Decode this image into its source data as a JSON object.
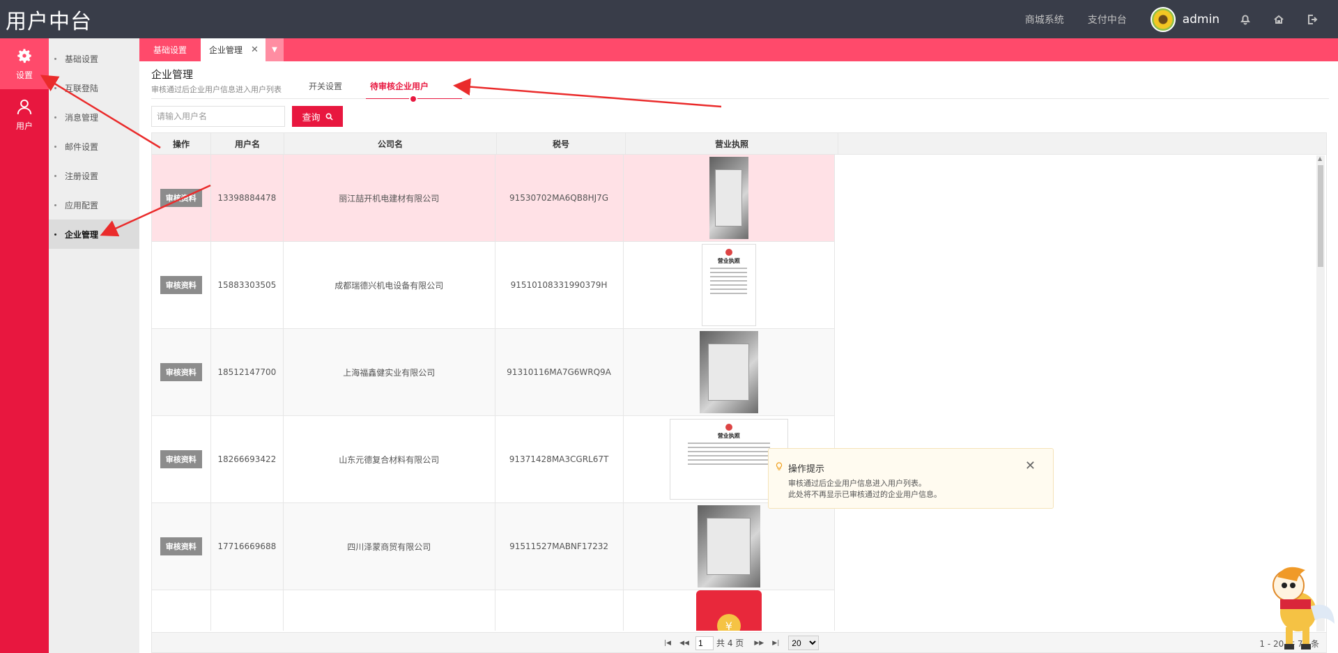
{
  "app": {
    "title": "用户中台"
  },
  "topbar": {
    "links": [
      "商城系统",
      "支付中台"
    ],
    "username": "admin",
    "icons": [
      "bell-icon",
      "home-icon",
      "logout-icon"
    ]
  },
  "leftnav": [
    {
      "label": "设置",
      "icon": "gear-icon",
      "active": true
    },
    {
      "label": "用户",
      "icon": "user-icon",
      "active": false
    }
  ],
  "submenu": [
    "基础设置",
    "互联登陆",
    "消息管理",
    "邮件设置",
    "注册设置",
    "应用配置",
    "企业管理"
  ],
  "tabs": [
    {
      "label": "基础设置"
    },
    {
      "label": "企业管理",
      "active": true
    }
  ],
  "page": {
    "title": "企业管理",
    "subtitle": "审核通过后企业用户信息进入用户列表",
    "subtabs": [
      "开关设置",
      "待审核企业用户"
    ]
  },
  "search": {
    "placeholder": "请输入用户名",
    "button": "查询"
  },
  "table": {
    "columns": [
      "操作",
      "用户名",
      "公司名",
      "税号",
      "营业执照"
    ],
    "action_label": "审核资料",
    "rows": [
      {
        "username": "13398884478",
        "company": "丽江喆开机电建材有限公司",
        "tax": "91530702MA6QB8HJ7G"
      },
      {
        "username": "15883303505",
        "company": "成都瑞德兴机电设备有限公司",
        "tax": "91510108331990379H"
      },
      {
        "username": "18512147700",
        "company": "上海福鑫健实业有限公司",
        "tax": "91310116MA7G6WRQ9A"
      },
      {
        "username": "18266693422",
        "company": "山东元德复合材料有限公司",
        "tax": "91371428MA3CGRL67T"
      },
      {
        "username": "17716669688",
        "company": "四川泽蒙商贸有限公司",
        "tax": "91511527MABNF17232"
      },
      {
        "username": "",
        "company": "",
        "tax": ""
      }
    ],
    "license_title": "营业执照"
  },
  "pager": {
    "page": "1",
    "total_pages": "共 4 页",
    "page_size": "20",
    "range": "1 - 20 共 76 条"
  },
  "tip": {
    "title": "操作提示",
    "line1": "审核通过后企业用户信息进入用户列表。",
    "line2": "此处将不再显示已审核通过的企业用户信息。"
  },
  "colors": {
    "accent": "#e8173f",
    "topbar": "#393d49",
    "tabs": "#ff4a6b"
  }
}
